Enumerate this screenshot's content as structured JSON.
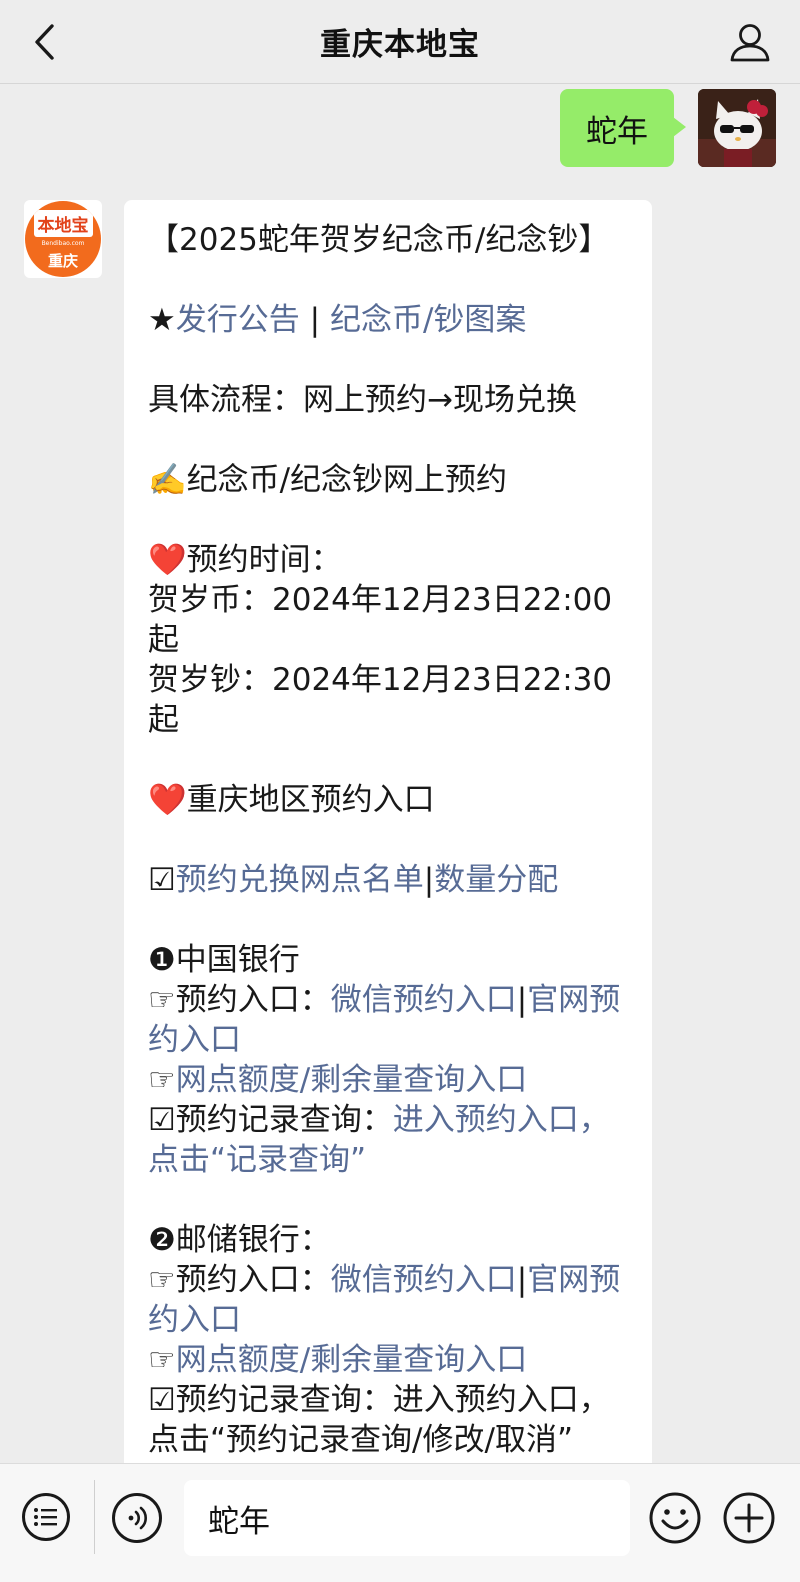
{
  "header": {
    "title": "重庆本地宝"
  },
  "outgoing": {
    "text": "蛇年"
  },
  "bot_avatar": {
    "logo_text": "本地宝",
    "logo_url": "Bendibao.com",
    "logo_city": "重庆"
  },
  "message": {
    "title": "【2025蛇年贺岁纪念币/纪念钞】",
    "l2_star": "★",
    "l2_link1": "发行公告",
    "l2_sep": " | ",
    "l2_link2": "纪念币/钞图案",
    "flow": "具体流程：网上预约→现场兑换",
    "online": "✍️纪念币/纪念钞网上预约",
    "time_head": "❤️预约时间：",
    "coin_time": "贺岁币：2024年12月23日22:00起",
    "note_time": "贺岁钞：2024年12月23日22:30起",
    "cq_entry": "❤️重庆地区预约入口",
    "check_mark": "☑",
    "list_link1": "预约兑换网点名单",
    "list_sep": "|",
    "list_link2": "数量分配",
    "boc": {
      "head": "❶中国银行",
      "entry_label": "☞预约入口：",
      "wx_link": "微信预约入口",
      "sep": "|",
      "site_link": "官网预约入口",
      "hand": "☞",
      "quota_link": "网点额度/剩余量查询入口",
      "record_label": "☑预约记录查询：",
      "record_link": "进入预约入口，点击“记录查询”"
    },
    "psbc": {
      "head": "❷邮储银行：",
      "entry_label": "☞预约入口：",
      "wx_link": "微信预约入口",
      "sep": "|",
      "site_link": "官网预约入口",
      "hand": "☞",
      "quota_link": "网点额度/剩余量查询入口",
      "record_text": "☑预约记录查询：进入预约入口，点击“预约记录查询/修改/取消”"
    }
  },
  "input_bar": {
    "value": "蛇年"
  }
}
